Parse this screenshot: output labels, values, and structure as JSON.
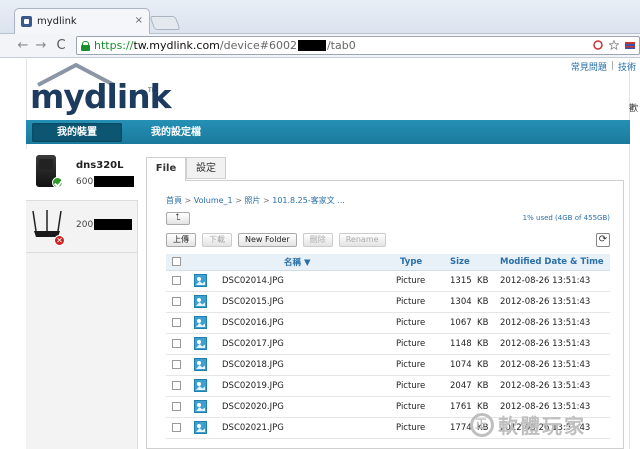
{
  "browser": {
    "tab_title": "mydlink",
    "tab_close": "×",
    "url_scheme": "https://",
    "url_host": "tw.mydlink.com",
    "url_path_prefix": "/device#6002",
    "url_path_suffix": "/tab0"
  },
  "header": {
    "top_links": [
      "常見問題",
      "技術"
    ],
    "logo": "mydlink",
    "logo_tm": "TM",
    "cut_text": "歡"
  },
  "nav": {
    "tabs": [
      {
        "label": "我的裝置",
        "active": true
      },
      {
        "label": "我的設定檔",
        "active": false
      }
    ]
  },
  "devices": [
    {
      "name": "dns320L",
      "id_prefix": "600",
      "status": "online"
    },
    {
      "name": "",
      "id_prefix": "200",
      "status": "error",
      "status_glyph": "✕"
    }
  ],
  "content_tabs": [
    "File",
    "設定"
  ],
  "breadcrumb": [
    "首頁",
    "Volume_1",
    "照片",
    "101.8.25-客家文 ..."
  ],
  "usage": "1% used (4GB of 455GB)",
  "actions": {
    "up_icon": "⮤",
    "buttons": [
      {
        "label": "上傳",
        "enabled": true
      },
      {
        "label": "下載",
        "enabled": false
      },
      {
        "label": "New Folder",
        "enabled": true
      },
      {
        "label": "刪除",
        "enabled": false
      },
      {
        "label": "Rename",
        "enabled": false
      }
    ],
    "refresh_icon": "⟳"
  },
  "table": {
    "columns": [
      "名稱 ▼",
      "Type",
      "Size",
      "Modified Date & Time"
    ],
    "rows": [
      {
        "name": "DSC02014.JPG",
        "type": "Picture",
        "size": "1315",
        "unit": "KB",
        "date": "2012-08-26 13:51:43"
      },
      {
        "name": "DSC02015.JPG",
        "type": "Picture",
        "size": "1304",
        "unit": "KB",
        "date": "2012-08-26 13:51:43"
      },
      {
        "name": "DSC02016.JPG",
        "type": "Picture",
        "size": "1067",
        "unit": "KB",
        "date": "2012-08-26 13:51:43"
      },
      {
        "name": "DSC02017.JPG",
        "type": "Picture",
        "size": "1148",
        "unit": "KB",
        "date": "2012-08-26 13:51:43"
      },
      {
        "name": "DSC02018.JPG",
        "type": "Picture",
        "size": "1074",
        "unit": "KB",
        "date": "2012-08-26 13:51:43"
      },
      {
        "name": "DSC02019.JPG",
        "type": "Picture",
        "size": "2047",
        "unit": "KB",
        "date": "2012-08-26 13:51:43"
      },
      {
        "name": "DSC02020.JPG",
        "type": "Picture",
        "size": "1761",
        "unit": "KB",
        "date": "2012-08-26 13:51:43"
      },
      {
        "name": "DSC02021.JPG",
        "type": "Picture",
        "size": "1774",
        "unit": "KB",
        "date": "2012-08-26 13:51:43"
      }
    ]
  },
  "watermark": {
    "icon": "正",
    "text": "軟體玩家"
  }
}
